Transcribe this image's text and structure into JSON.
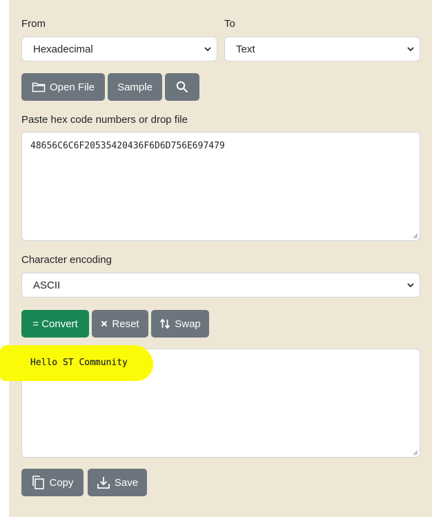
{
  "from": {
    "label": "From",
    "value": "Hexadecimal"
  },
  "to": {
    "label": "To",
    "value": "Text"
  },
  "toolbar": {
    "open_file_label": "Open File",
    "sample_label": "Sample"
  },
  "input": {
    "label": "Paste hex code numbers or drop file",
    "value": "48656C6C6F20535420436F6D6D756E697479"
  },
  "encoding": {
    "label": "Character encoding",
    "value": "ASCII"
  },
  "actions": {
    "convert_label": "= Convert",
    "reset_label": "Reset",
    "swap_label": "Swap"
  },
  "output": {
    "value": "Hello ST Community"
  },
  "bottom": {
    "copy_label": "Copy",
    "save_label": "Save"
  },
  "colors": {
    "panel_bg": "#efe7d5",
    "button_gray": "#6c757d",
    "button_green": "#198754",
    "highlight": "#fbfb07"
  }
}
